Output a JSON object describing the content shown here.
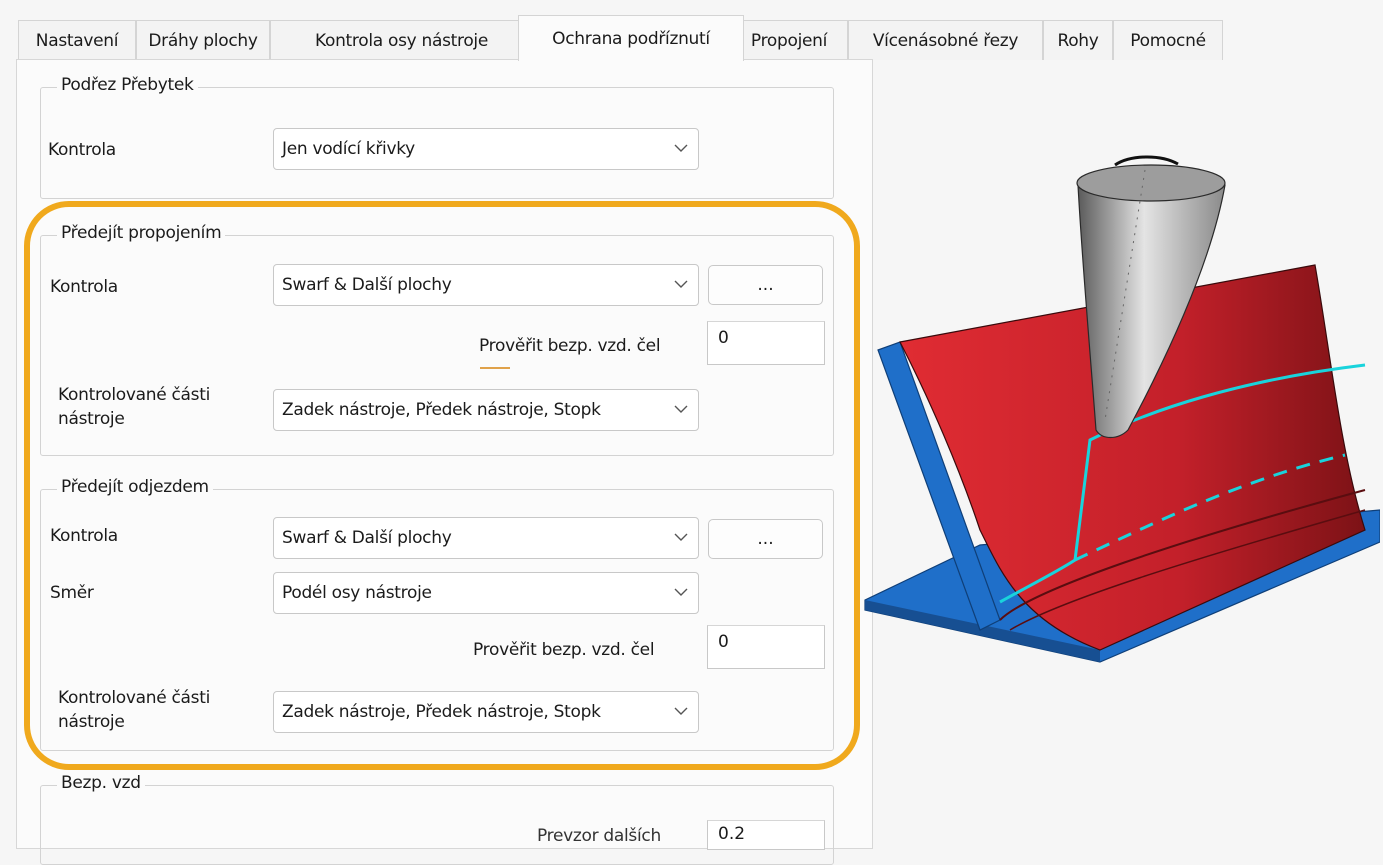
{
  "tabs": [
    {
      "label": "Nastavení",
      "active": false
    },
    {
      "label": "Dráhy plochy",
      "active": false
    },
    {
      "label": "Kontrola osy nástroje",
      "active": false
    },
    {
      "label": "Ochrana podříznutí",
      "active": true
    },
    {
      "label": "Propojení",
      "active": false
    },
    {
      "label": "Vícenásobné řezy",
      "active": false
    },
    {
      "label": "Rohy",
      "active": false
    },
    {
      "label": "Pomocné",
      "active": false
    }
  ],
  "gouge_excess": {
    "title": "Podřez Přebytek",
    "check_label": "Kontrola",
    "check_value": "Jen vodící křivky"
  },
  "avoid_links": {
    "title": "Předejít propojením",
    "check_label": "Kontrola",
    "check_value": "Swarf & Další plochy",
    "more_label": "...",
    "clearance_label": "Prověřit bezp. vzd. čel",
    "clearance_value": "0",
    "parts_label_1": "Kontrolované části",
    "parts_label_2": "nástroje",
    "parts_value": "Zadek nástroje, Předek nástroje, Stopk"
  },
  "avoid_retract": {
    "title": "Předejít odjezdem",
    "check_label": "Kontrola",
    "check_value": "Swarf & Další plochy",
    "more_label": "...",
    "direction_label": "Směr",
    "direction_value": "Podél osy nástroje",
    "clearance_label": "Prověřit bezp. vzd. čel",
    "clearance_value": "0",
    "parts_label_1": "Kontrolované části",
    "parts_label_2": "nástroje",
    "parts_value": "Zadek nástroje, Předek nástroje, Stopk"
  },
  "safety": {
    "title": "Bezp. vzd",
    "partial_label": "Prevzor dalších",
    "partial_value": "0.2"
  },
  "colors": {
    "highlight": "#f0a91d",
    "surface_red": "#c8222b",
    "surface_blue": "#1f6fc9",
    "toolpath_cyan": "#19d3dc"
  },
  "icons": {
    "dropdown": "chevron-down-icon",
    "illustration": "swarf-gouge-illustration"
  }
}
